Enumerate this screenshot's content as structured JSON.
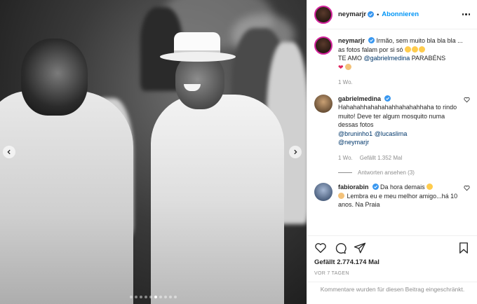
{
  "post": {
    "author": "neymarjr",
    "follow_label": "Abonnieren",
    "separator": "•",
    "caption_text": "Irmão, sem muito bla bla bla ... as fotos falam por si só",
    "caption_text2": "TE AMO",
    "caption_mention": "@gabrielmedina",
    "caption_tail": "PARABÉNS",
    "caption_time": "1 Wo."
  },
  "comments": [
    {
      "user": "gabrielmedina",
      "text": "Hahahahhahahahahhahahahhaha to rindo muito! Deve ter algum mosquito numa dessas fotos",
      "mentions": [
        "@bruninho1",
        "@lucaslima",
        "@neymarjr"
      ],
      "time": "1 Wo.",
      "likes": "Gefällt 1.352 Mal",
      "replies": "Antworten ansehen (3)"
    },
    {
      "user": "fabiorabin",
      "text1": "Da hora demais",
      "text2": "Lembra eu e meu melhor amigo...há 10 anos. Na Praia"
    }
  ],
  "footer": {
    "likes": "Gefällt 2.774.174 Mal",
    "date": "VOR 7 TAGEN",
    "disabled_note": "Kommentare wurden für diesen Beitrag eingeschränkt."
  },
  "carousel": {
    "total": 10,
    "active": 5
  },
  "icons": {
    "like": "heart-icon",
    "comment": "comment-icon",
    "share": "share-icon",
    "save": "bookmark-icon",
    "verified": "verified-badge-icon"
  },
  "colors": {
    "accent": "#0095f6",
    "verified": "#3897f0",
    "text": "#262626",
    "muted": "#8e8e8e"
  }
}
